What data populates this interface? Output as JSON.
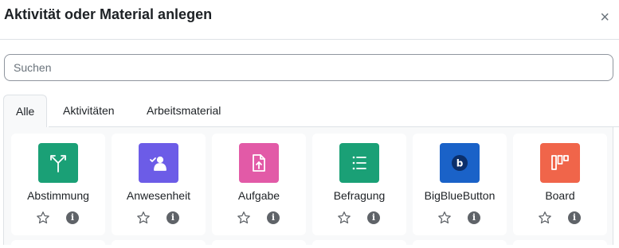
{
  "dialog": {
    "title": "Aktivität oder Material anlegen",
    "close_symbol": "×"
  },
  "search": {
    "placeholder": "Suchen",
    "value": ""
  },
  "tabs": [
    {
      "label": "Alle",
      "active": true
    },
    {
      "label": "Aktivitäten",
      "active": false
    },
    {
      "label": "Arbeitsmaterial",
      "active": false
    }
  ],
  "modules": [
    {
      "name": "Abstimmung",
      "icon": "choice-icon",
      "color": "#1aa076"
    },
    {
      "name": "Anwesenheit",
      "icon": "attendance-icon",
      "color": "#6c5ce7"
    },
    {
      "name": "Aufgabe",
      "icon": "assignment-icon",
      "color": "#e25aa7"
    },
    {
      "name": "Befragung",
      "icon": "feedback-icon",
      "color": "#1aa076"
    },
    {
      "name": "BigBlueButton",
      "icon": "bigbluebutton-icon",
      "color": "#1a62c8"
    },
    {
      "name": "Board",
      "icon": "board-icon",
      "color": "#f0654a"
    }
  ],
  "colors": {
    "star": "#5f6368",
    "info_bg": "#5f6368"
  }
}
